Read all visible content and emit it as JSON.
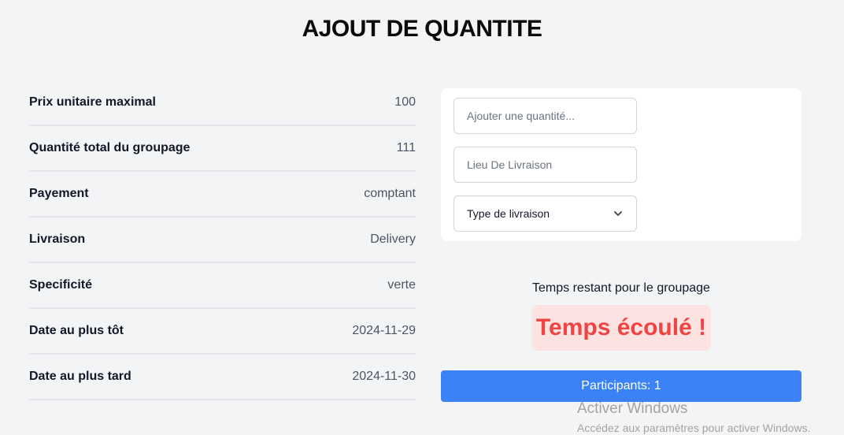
{
  "page": {
    "title": "AJOUT DE QUANTITE"
  },
  "details": [
    {
      "label": "Prix unitaire maximal",
      "value": "100"
    },
    {
      "label": "Quantité total du groupage",
      "value": "111"
    },
    {
      "label": "Payement",
      "value": "comptant"
    },
    {
      "label": "Livraison",
      "value": "Delivery"
    },
    {
      "label": "Specificité",
      "value": "verte"
    },
    {
      "label": "Date au plus tôt",
      "value": "2024-11-29"
    },
    {
      "label": "Date au plus tard",
      "value": "2024-11-30"
    }
  ],
  "form": {
    "quantity": {
      "placeholder": "Ajouter une quantité...",
      "value": ""
    },
    "location": {
      "placeholder": "Lieu De Livraison",
      "value": ""
    },
    "delivery_type": {
      "selected": "Type de livraison",
      "icon": "chevron-down-icon"
    }
  },
  "timer": {
    "label": "Temps restant pour le groupage",
    "status": "Temps écoulé !",
    "status_color": "#ef4444",
    "badge_bg": "#fde2e2"
  },
  "participants_button": {
    "label": "Participants: 1",
    "color": "#3b82f6"
  },
  "watermark": {
    "title": "Activer Windows",
    "subtitle": "Accédez aux paramètres pour activer Windows."
  }
}
